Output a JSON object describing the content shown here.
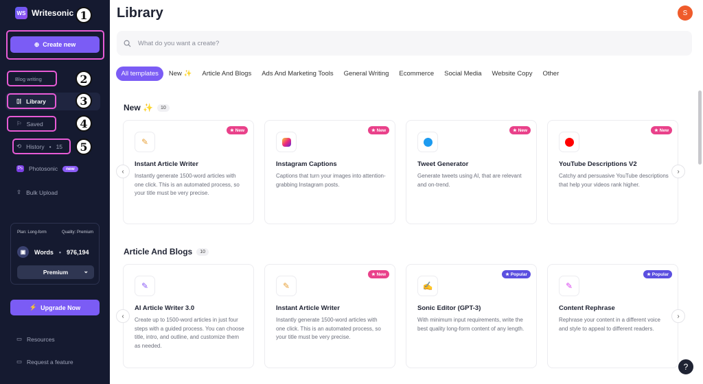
{
  "app": {
    "name": "Writesonic",
    "logo_text": "WS"
  },
  "sidebar": {
    "create_label": "Create new",
    "items": [
      {
        "label": "Blog writing"
      },
      {
        "label": "Library"
      },
      {
        "label": "Saved"
      },
      {
        "label": "History",
        "count": "15",
        "sep": "•"
      },
      {
        "label": "Photosonic",
        "badge": "new"
      },
      {
        "label": "Bulk Upload"
      }
    ],
    "annotations": [
      "1",
      "2",
      "3",
      "4",
      "5"
    ],
    "plan": {
      "plan_label": "Plan: Long-form",
      "quality_label": "Quality: Premium",
      "words_label": "Words",
      "sep": "•",
      "words_value": "976,194",
      "tier": "Premium"
    },
    "upgrade_label": "Upgrade Now",
    "footer": [
      {
        "label": "Resources"
      },
      {
        "label": "Request a feature"
      }
    ]
  },
  "header": {
    "title": "Library",
    "avatar_initial": "S"
  },
  "search": {
    "placeholder": "What do you want a create?"
  },
  "tabs": [
    "All templates",
    "New ✨",
    "Article And Blogs",
    "Ads And Marketing Tools",
    "General Writing",
    "Ecommerce",
    "Social Media",
    "Website Copy",
    "Other"
  ],
  "sections": [
    {
      "title": "New ✨",
      "count": "10",
      "cards": [
        {
          "title": "Instant Article Writer",
          "desc": "Instantly generate 1500-word articles with one click. This is an automated process, so your title must be very precise.",
          "badge": "★ New",
          "icon": "article-icon"
        },
        {
          "title": "Instagram Captions",
          "desc": "Captions that turn your images into attention-grabbing Instagram posts.",
          "badge": "★ New",
          "icon": "instagram-icon"
        },
        {
          "title": "Tweet Generator",
          "desc": "Generate tweets using AI, that are relevant and on-trend.",
          "badge": "★ New",
          "icon": "twitter-icon"
        },
        {
          "title": "YouTube Descriptions V2",
          "desc": "Catchy and persuasive YouTube descriptions that help your videos rank higher.",
          "badge": "★ New",
          "icon": "youtube-icon"
        }
      ]
    },
    {
      "title": "Article And Blogs",
      "count": "10",
      "cards": [
        {
          "title": "AI Article Writer 3.0",
          "desc": "Create up to 1500-word articles in just four steps with a guided process. You can choose title, intro, and outline, and customize them as needed.",
          "badge": "",
          "icon": "article-writer-icon"
        },
        {
          "title": "Instant Article Writer",
          "desc": "Instantly generate 1500-word articles with one click. This is an automated process, so your title must be very precise.",
          "badge": "★ New",
          "icon": "article-icon"
        },
        {
          "title": "Sonic Editor (GPT-3)",
          "desc": "With minimum input requirements, write the best quality long-form content of any length.",
          "badge": "★ Popular",
          "icon": "edit-icon"
        },
        {
          "title": "Content Rephrase",
          "desc": "Rephrase your content in a different voice and style to appeal to different readers.",
          "badge": "★ Popular",
          "icon": "rephrase-icon"
        }
      ]
    }
  ],
  "colors": {
    "accent": "#7b5cf5",
    "new_badge": "#e9418a",
    "popular_badge": "#5b4fe0",
    "sidebar_bg": "#151a30"
  }
}
